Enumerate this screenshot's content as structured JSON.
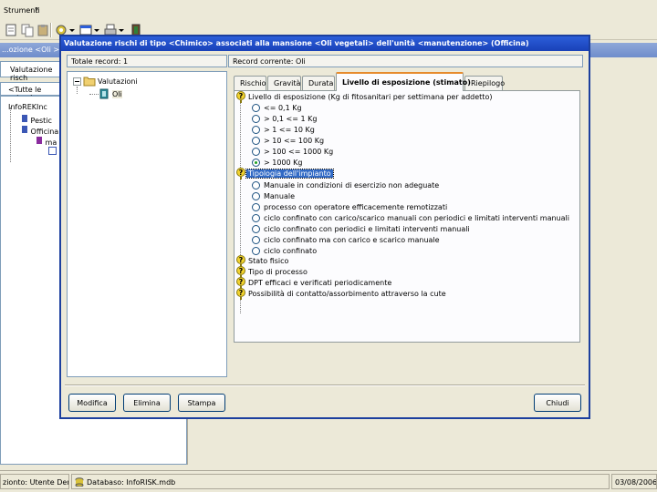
{
  "app": {
    "menu": [
      "Strumenti",
      "?"
    ],
    "window_title": "...ozione <Oli >",
    "window_tabs": [
      "Valutazione risch",
      "<Tutte le esiende"
    ],
    "tree": [
      {
        "label": "InfoREKInc"
      },
      {
        "label": "Pestic"
      },
      {
        "label": "Officina"
      },
      {
        "label": "ma"
      }
    ]
  },
  "status": {
    "session": "zionto: Utente Demo",
    "database": "Databaso: InfoRISK.mdb",
    "date": "03/08/2006"
  },
  "dialog": {
    "title": "Valutazione rischi di tipo <Chimico> associati alla mansione <Oli vegetali> dell'unità <manutenzione> (Officina)",
    "total_records": "Totale record: 1",
    "current_record": "Record corrente: Oli",
    "tree": {
      "root": "Valutazioni",
      "child": "Oli"
    },
    "tabs": [
      {
        "label": "Rischio",
        "active": false
      },
      {
        "label": "Gravità",
        "active": false
      },
      {
        "label": "Durata",
        "active": false
      },
      {
        "label": "Livello di esposizione (stimato)",
        "active": true
      },
      {
        "label": "Riepilogo",
        "active": false
      }
    ],
    "exposure": {
      "heading": "Livello di esposizione (Kg di fitosanitari per settimana per addetto)",
      "options": [
        {
          "label": "<= 0,1 Kg",
          "selected": false
        },
        {
          "label": "> 0,1 <= 1 Kg",
          "selected": false
        },
        {
          "label": "> 1 <= 10 Kg",
          "selected": false
        },
        {
          "label": "> 10 <= 100 Kg",
          "selected": false
        },
        {
          "label": "> 100 <= 1000 Kg",
          "selected": false
        },
        {
          "label": "> 1000 Kg",
          "selected": true
        }
      ]
    },
    "plant": {
      "heading": "Tipologia dell'impianto",
      "options": [
        {
          "label": "Manuale in condizioni di esercizio non adeguate"
        },
        {
          "label": "Manuale"
        },
        {
          "label": "processo con operatore efficacemente remotizzati"
        },
        {
          "label": "ciclo confinato con carico/scarico manuali con periodici e limitati interventi manuali"
        },
        {
          "label": "ciclo confinato con periodici e limitati interventi manuali"
        },
        {
          "label": "ciclo confinato ma con carico e scarico manuale"
        },
        {
          "label": "ciclo confinato"
        }
      ]
    },
    "other_items": [
      "Stato fisico",
      "Tipo di processo",
      "DPT efficaci e verificati periodicamente",
      "Possibilità di contatto/assorbimento attraverso la cute"
    ],
    "buttons": {
      "modify": "Modifica",
      "delete": "Elimina",
      "print": "Stampa",
      "close": "Chiudi"
    }
  },
  "colors": {
    "title_bar": "#1941b8",
    "selection": "#316ac5",
    "active_tab_accent": "#e68b2c",
    "background": "#ece9d8"
  }
}
